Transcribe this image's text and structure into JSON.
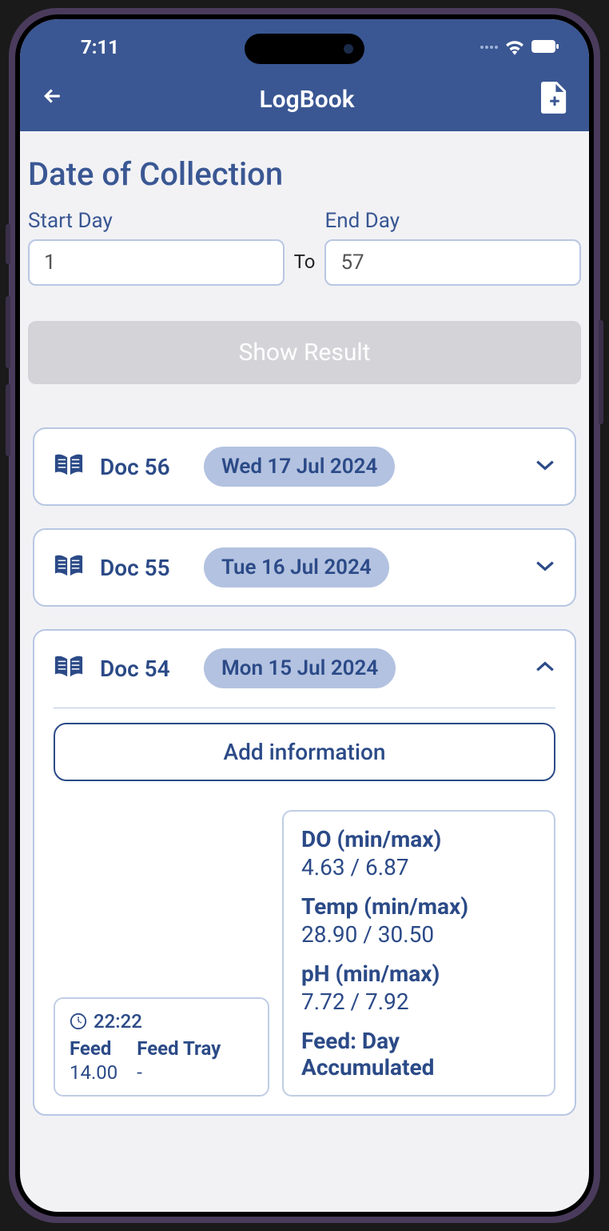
{
  "status": {
    "time": "7:11"
  },
  "header": {
    "title": "LogBook"
  },
  "collection": {
    "title": "Date of Collection",
    "start_label": "Start Day",
    "start_value": "1",
    "to_label": "To",
    "end_label": "End Day",
    "end_value": "57",
    "show_result": "Show Result"
  },
  "docs": [
    {
      "name": "Doc 56",
      "date": "Wed 17 Jul 2024",
      "expanded": false
    },
    {
      "name": "Doc 55",
      "date": "Tue 16 Jul 2024",
      "expanded": false
    },
    {
      "name": "Doc 54",
      "date": "Mon 15 Jul 2024",
      "expanded": true
    }
  ],
  "expanded": {
    "add_info": "Add information",
    "feed": {
      "time": "22:22",
      "feed_label": "Feed",
      "feed_value": "14.00",
      "tray_label": "Feed Tray",
      "tray_value": "-"
    },
    "metrics": {
      "do_label": "DO (min/max)",
      "do_value": "4.63 / 6.87",
      "temp_label": "Temp (min/max)",
      "temp_value": "28.90 / 30.50",
      "ph_label": "pH (min/max)",
      "ph_value": "7.72 / 7.92",
      "feedday_label": "Feed: Day Accumulated"
    }
  }
}
